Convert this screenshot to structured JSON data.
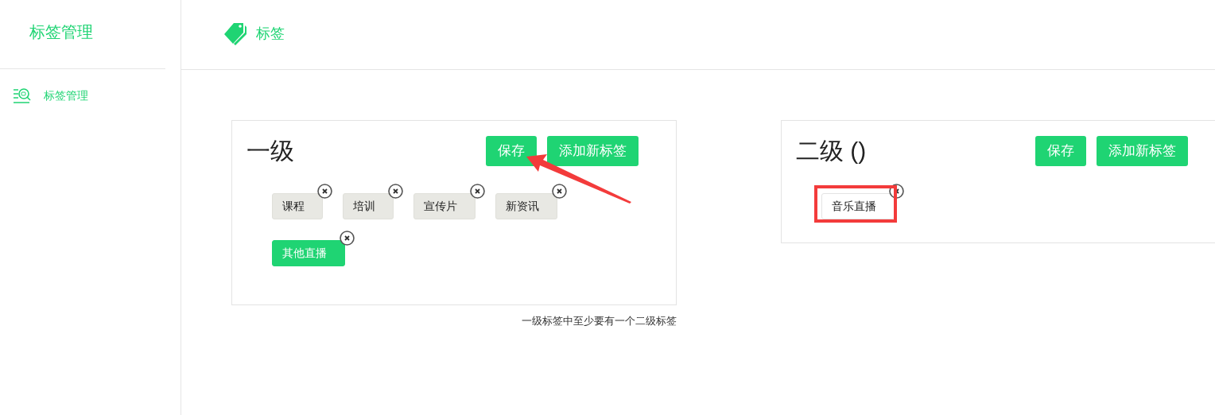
{
  "sidebar": {
    "title": "标签管理",
    "items": [
      {
        "label": "标签管理",
        "selected": true
      }
    ]
  },
  "header": {
    "title": "标签"
  },
  "panels": [
    {
      "kind": "primary",
      "title": "一级",
      "buttons": [
        "保存",
        "添加新标签"
      ],
      "tags": [
        {
          "label": "课程",
          "selected": false
        },
        {
          "label": "培训",
          "selected": false
        },
        {
          "label": "宣传片",
          "selected": false
        },
        {
          "label": "新资讯",
          "selected": false
        },
        {
          "label": "其他直播",
          "selected": true
        }
      ],
      "note": "一级标签中至少要有一个二级标签"
    },
    {
      "kind": "secondary",
      "title": "二级 ()",
      "buttons": [
        "保存",
        "添加新标签"
      ],
      "tags": [
        {
          "label": "音乐直播",
          "selected": false
        }
      ]
    }
  ]
}
